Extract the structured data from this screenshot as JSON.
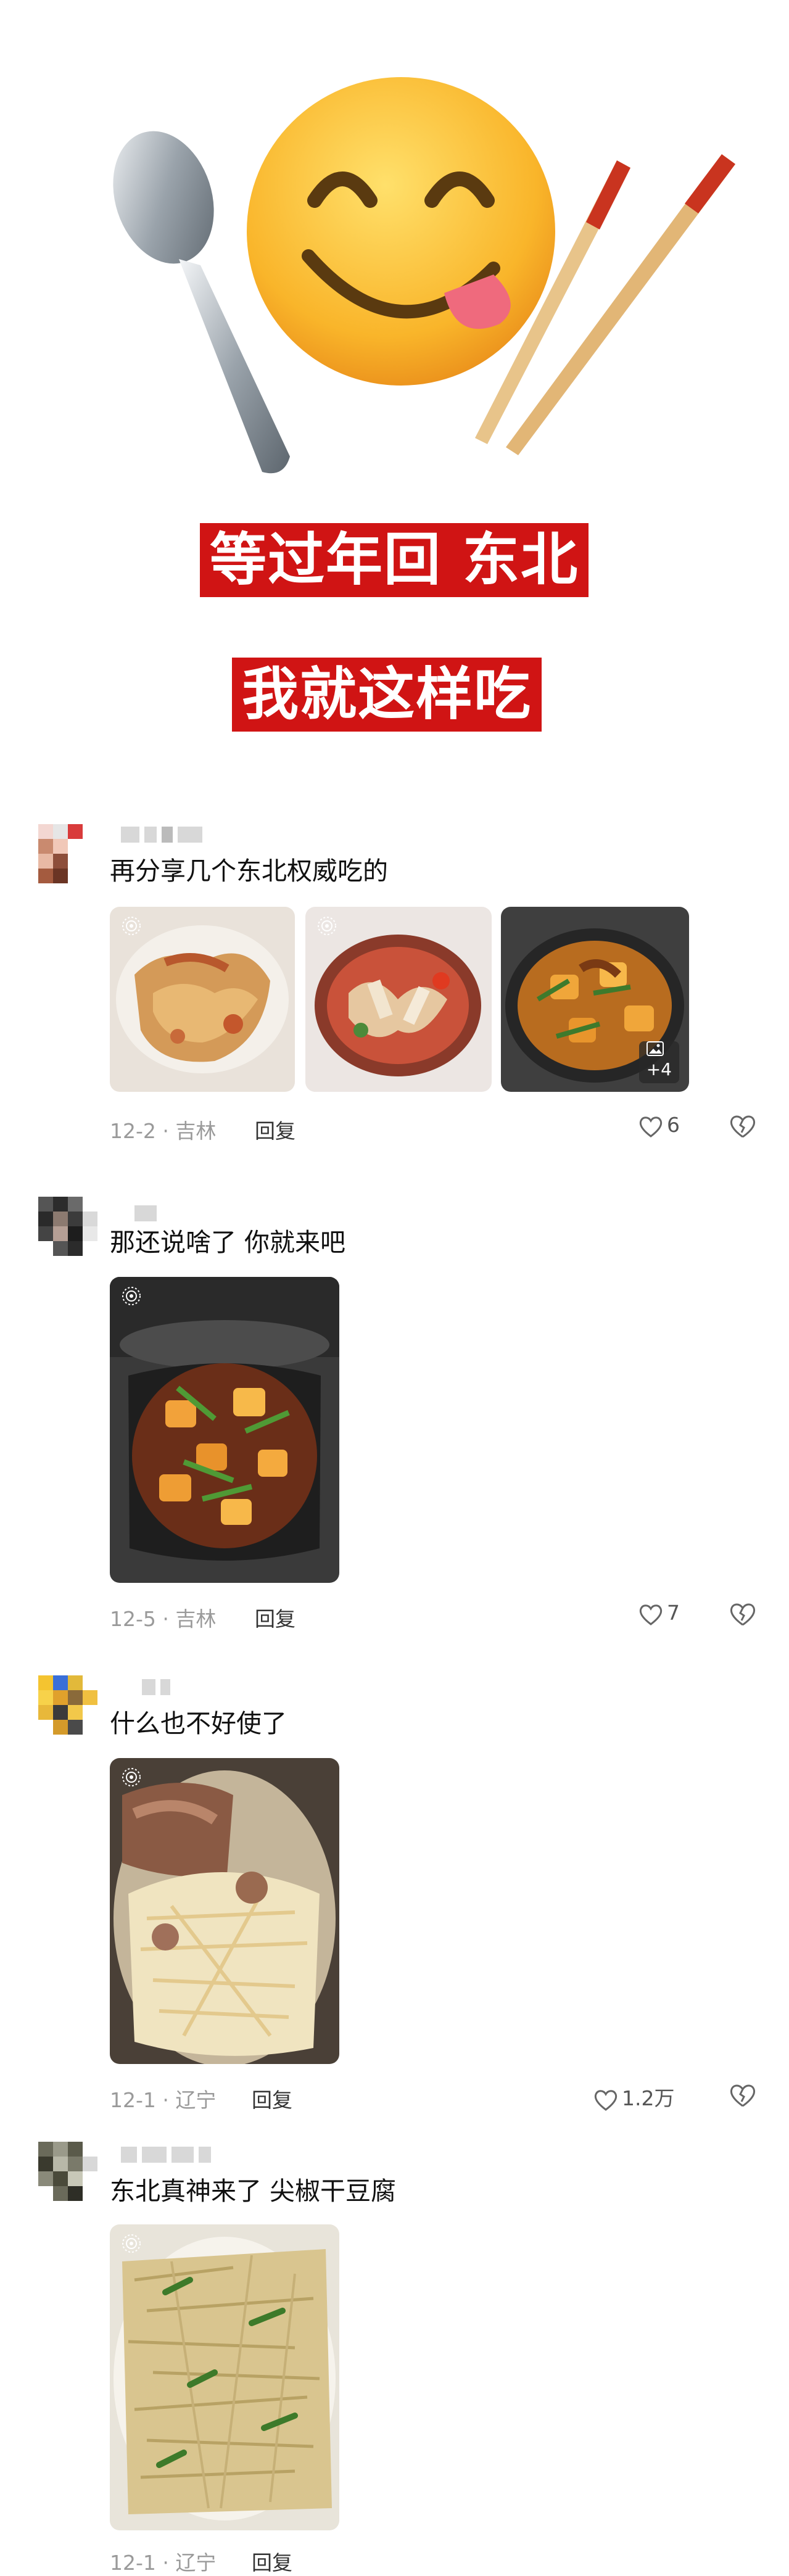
{
  "headline": {
    "line1": "等过年回 东北",
    "line2": "我就这样吃"
  },
  "comments": [
    {
      "text": "再分享几个东北权威吃的",
      "date": "12-2 · 吉林",
      "reply": "回复",
      "likes": "6",
      "more_images": "+4"
    },
    {
      "text": "那还说啥了 你就来吧",
      "date": "12-5 · 吉林",
      "reply": "回复",
      "likes": "7"
    },
    {
      "text": "什么也不好使了",
      "date": "12-1 · 辽宁",
      "reply": "回复",
      "likes": "1.2万"
    },
    {
      "text": "东北真神来了 尖椒干豆腐",
      "date": "12-1 · 辽宁",
      "reply": "回复"
    }
  ],
  "colors": {
    "banner": "#d01414",
    "meta": "#9a9a9a"
  },
  "icons": [
    "spoon-icon",
    "chopsticks-icon",
    "yum-emoji-icon",
    "heart-icon",
    "broken-heart-icon",
    "gallery-icon",
    "live-photo-icon"
  ]
}
